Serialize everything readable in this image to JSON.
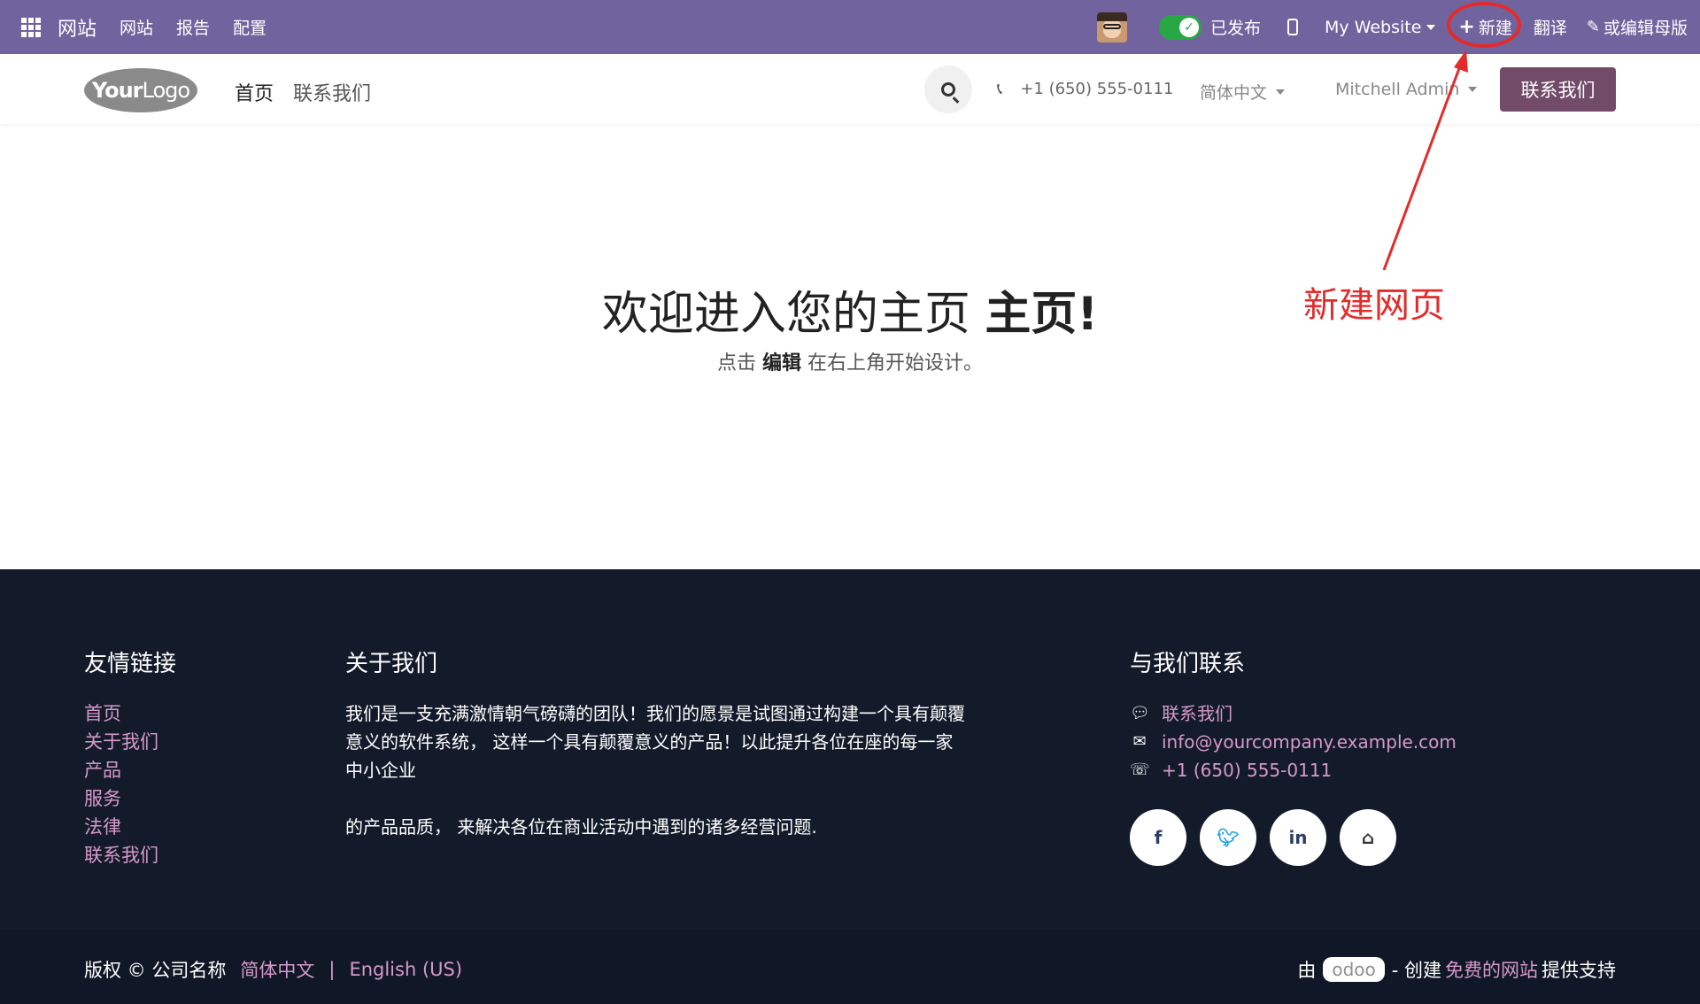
{
  "admin_bar": {
    "brand": "网站",
    "menu": [
      "网站",
      "报告",
      "配置"
    ],
    "publish_label": "已发布",
    "website_select": "My Website",
    "new_label": "新建",
    "translate_label": "翻译",
    "edit_label": "或编辑母版",
    "bg_color": "#71639e"
  },
  "header": {
    "logo_your": "Your",
    "logo_logo": "Logo",
    "nav": [
      "首页",
      "联系我们"
    ],
    "phone": "+1 (650) 555-0111",
    "language": "简体中文",
    "user": "Mitchell Admin",
    "contact_button": "联系我们",
    "accent_color": "#714b67"
  },
  "hero": {
    "title_prefix": "欢迎进入您的主页",
    "title_bold": "主页",
    "title_suffix": "!",
    "subtitle_prefix": "点击",
    "subtitle_bold": "编辑",
    "subtitle_suffix": "在右上角开始设计。"
  },
  "annotation": {
    "text": "新建网页",
    "color": "#e32b2b"
  },
  "footer": {
    "links_title": "友情链接",
    "links": [
      "首页",
      "关于我们",
      "产品",
      "服务",
      "法律",
      "联系我们"
    ],
    "about_title": "关于我们",
    "about_p1": "我们是一支充满激情朝气磅礴的团队！我们的愿景是试图通过构建一个具有颠覆意义的软件系统， 这样一个具有颠覆意义的产品！以此提升各位在座的每一家中小企业",
    "about_p2": "的产品品质， 来解决各位在商业活动中遇到的诸多经营问题.",
    "contact_title": "与我们联系",
    "contact_link": "联系我们",
    "email": "info@yourcompany.example.com",
    "phone": "+1 (650) 555-0111",
    "socials": [
      "f",
      "t",
      "in",
      "home"
    ],
    "link_color": "#d699c9",
    "bg_color": "#131b2b"
  },
  "copyright": {
    "text": "版权 © 公司名称",
    "lang_zh": "简体中文",
    "separator": "|",
    "lang_en": "English (US)",
    "by": "由",
    "odoo": "odoo",
    "dash_create": "- 创建",
    "free_site": "免费的网站",
    "support": "提供支持"
  }
}
